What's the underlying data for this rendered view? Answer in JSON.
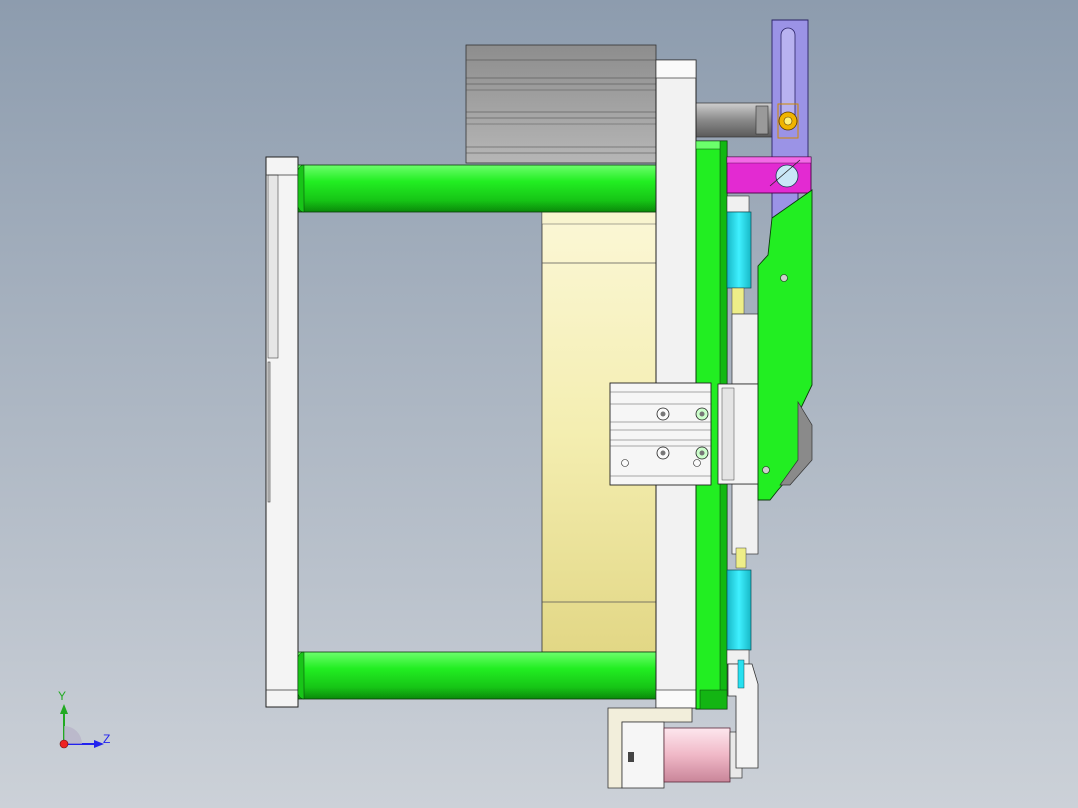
{
  "colors": {
    "background_top": "#8e9db0",
    "background_bottom": "#c9ced5",
    "green": "#22ee22",
    "green_dark": "#0a9a0a",
    "white_part": "#f2f2f2",
    "cream": "#f3efb8",
    "cyan": "#27e0f0",
    "magenta": "#e32ad2",
    "lavender": "#9b93e6",
    "gray_block": "#a4a4a4",
    "pink": "#f0b8c7",
    "axis_y": "#22aa22",
    "axis_z": "#2222ee",
    "axis_x": "#ee2222"
  },
  "axis_triad": {
    "y_label": "Y",
    "z_label": "Z"
  },
  "icons": {
    "triad": "coordinate-triad-icon"
  }
}
